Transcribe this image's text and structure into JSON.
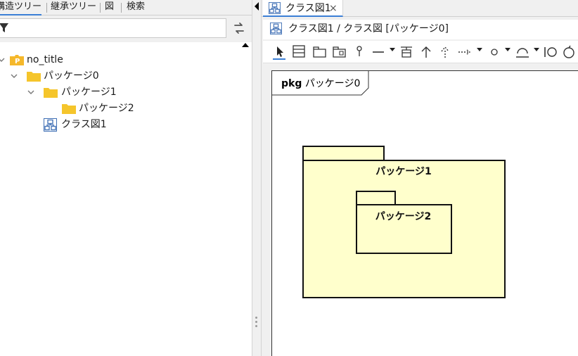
{
  "left_tabs": {
    "structure_tree": "構造ツリー",
    "inheritance_tree": "継承ツリー",
    "diagram": "図",
    "search": "検索"
  },
  "tree": {
    "root": "no_title",
    "package0": "パッケージ0",
    "package1": "パッケージ1",
    "package2": "パッケージ2",
    "class_diagram": "クラス図1"
  },
  "editor": {
    "tab_label": "クラス図1",
    "close_glyph": "×",
    "breadcrumb": "クラス図1 / クラス図 [パッケージ0]"
  },
  "diagram": {
    "frame_keyword": "pkg",
    "frame_name": "パッケージ0",
    "package1_name": "パッケージ1",
    "package2_name": "パッケージ2",
    "package_fill": "#ffffcc"
  },
  "icons": {
    "sync": "sync-icon",
    "filter": "filter-icon",
    "root_package": "project-p-icon",
    "folder": "folder-icon",
    "class_diagram": "class-diagram-icon"
  },
  "colors": {
    "folder": "#f5c52b",
    "accent": "#3b7fd6",
    "project_icon": "#f5b82b"
  }
}
